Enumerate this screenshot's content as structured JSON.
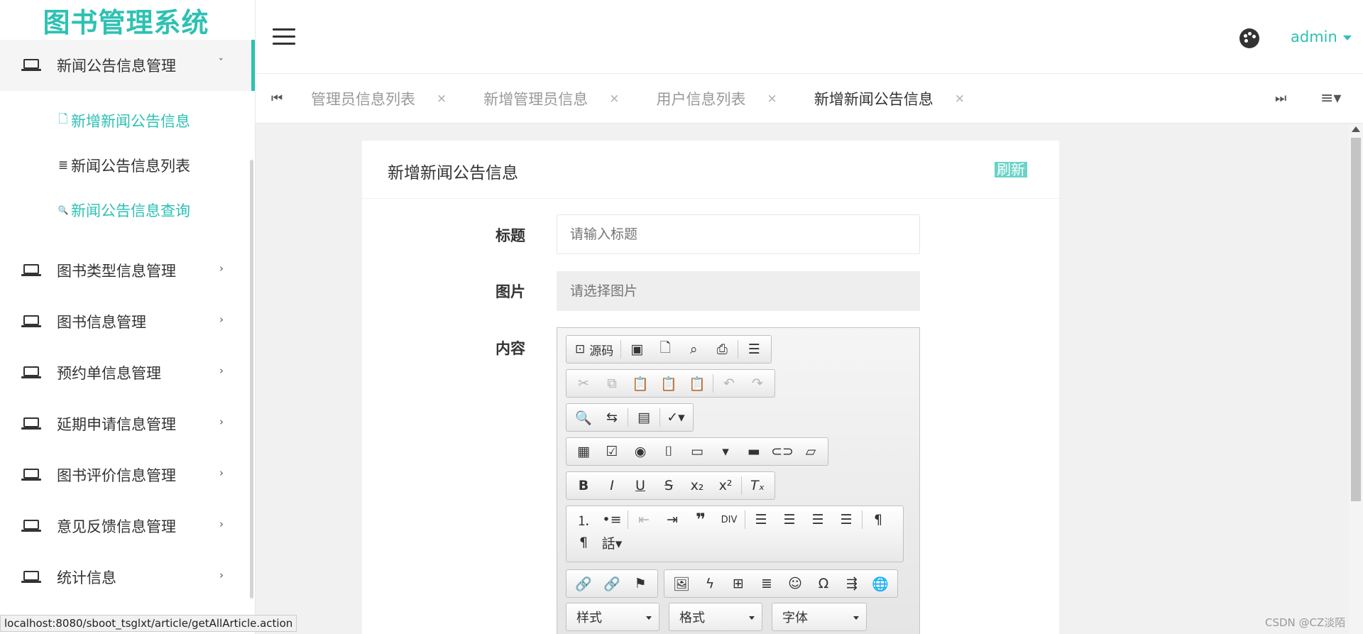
{
  "app": {
    "logo": "图书管理系统"
  },
  "sidebar": {
    "items": [
      {
        "label": "新闻公告信息管理",
        "chevron": "ˇ",
        "expanded": true,
        "children": [
          {
            "icon": "🗋",
            "label": "新增新闻公告信息"
          },
          {
            "icon": "≣",
            "label": "新闻公告信息列表"
          },
          {
            "icon": "🔍",
            "label": "新闻公告信息查询"
          }
        ]
      },
      {
        "label": "图书类型信息管理",
        "chevron": "›"
      },
      {
        "label": "图书信息管理",
        "chevron": "›"
      },
      {
        "label": "预约单信息管理",
        "chevron": "›"
      },
      {
        "label": "延期申请信息管理",
        "chevron": "›"
      },
      {
        "label": "图书评价信息管理",
        "chevron": "›"
      },
      {
        "label": "意见反馈信息管理",
        "chevron": "›"
      },
      {
        "label": "统计信息",
        "chevron": "›"
      }
    ]
  },
  "header": {
    "user": "admin"
  },
  "tabs": {
    "prev_icon": "⏮",
    "next_icon": "⏭",
    "menu_icon": "≡▾",
    "close": "×",
    "items": [
      {
        "label": "管理员信息列表"
      },
      {
        "label": "新增管理员信息"
      },
      {
        "label": "用户信息列表"
      },
      {
        "label": "新增新闻公告信息"
      }
    ]
  },
  "form": {
    "title": "新增新闻公告信息",
    "refresh": "刷新",
    "title_label": "标题",
    "title_placeholder": "请输入标题",
    "image_label": "图片",
    "image_placeholder": "请选择图片",
    "content_label": "内容"
  },
  "editor": {
    "source": "源码",
    "style": "样式",
    "format": "格式",
    "font": "字体"
  },
  "status": {
    "url": "localhost:8080/sboot_tsglxt/article/getAllArticle.action",
    "watermark": "CSDN @CZ淡陌"
  },
  "colors": {
    "accent": "#2ec1b3"
  }
}
